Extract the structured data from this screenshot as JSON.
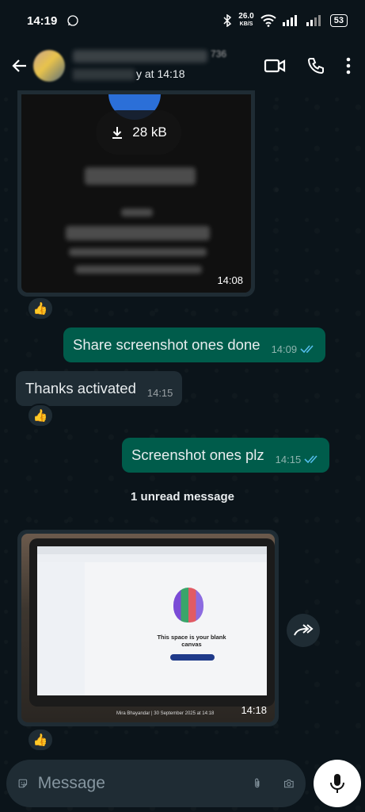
{
  "status_bar": {
    "time": "14:19",
    "net_speed": "26.0",
    "net_unit": "KB/S",
    "battery": "53"
  },
  "header": {
    "contact_name_suffix": "736",
    "last_seen_suffix": "y at 14:18"
  },
  "messages": {
    "file_message": {
      "size_label": "28 kB",
      "time": "14:08",
      "reaction": "👍"
    },
    "msg1": {
      "text": "Share screenshot ones done",
      "time": "14:09"
    },
    "msg2": {
      "text": "Thanks activated",
      "time": "14:15",
      "reaction": "👍"
    },
    "msg3": {
      "text": "Screenshot ones plz",
      "time": "14:15"
    },
    "unread_divider": "1 unread message",
    "photo_message": {
      "screen_text": "This space is your blank canvas",
      "caption": "Mira Bhayandar | 30 September 2025 at 14:18",
      "time": "14:18",
      "reaction": "👍"
    }
  },
  "composer": {
    "placeholder": "Message"
  },
  "colors": {
    "outgoing_bubble": "#005c4b",
    "incoming_bubble": "#1f2c34",
    "read_ticks": "#53bdeb",
    "background": "#0b141a"
  }
}
